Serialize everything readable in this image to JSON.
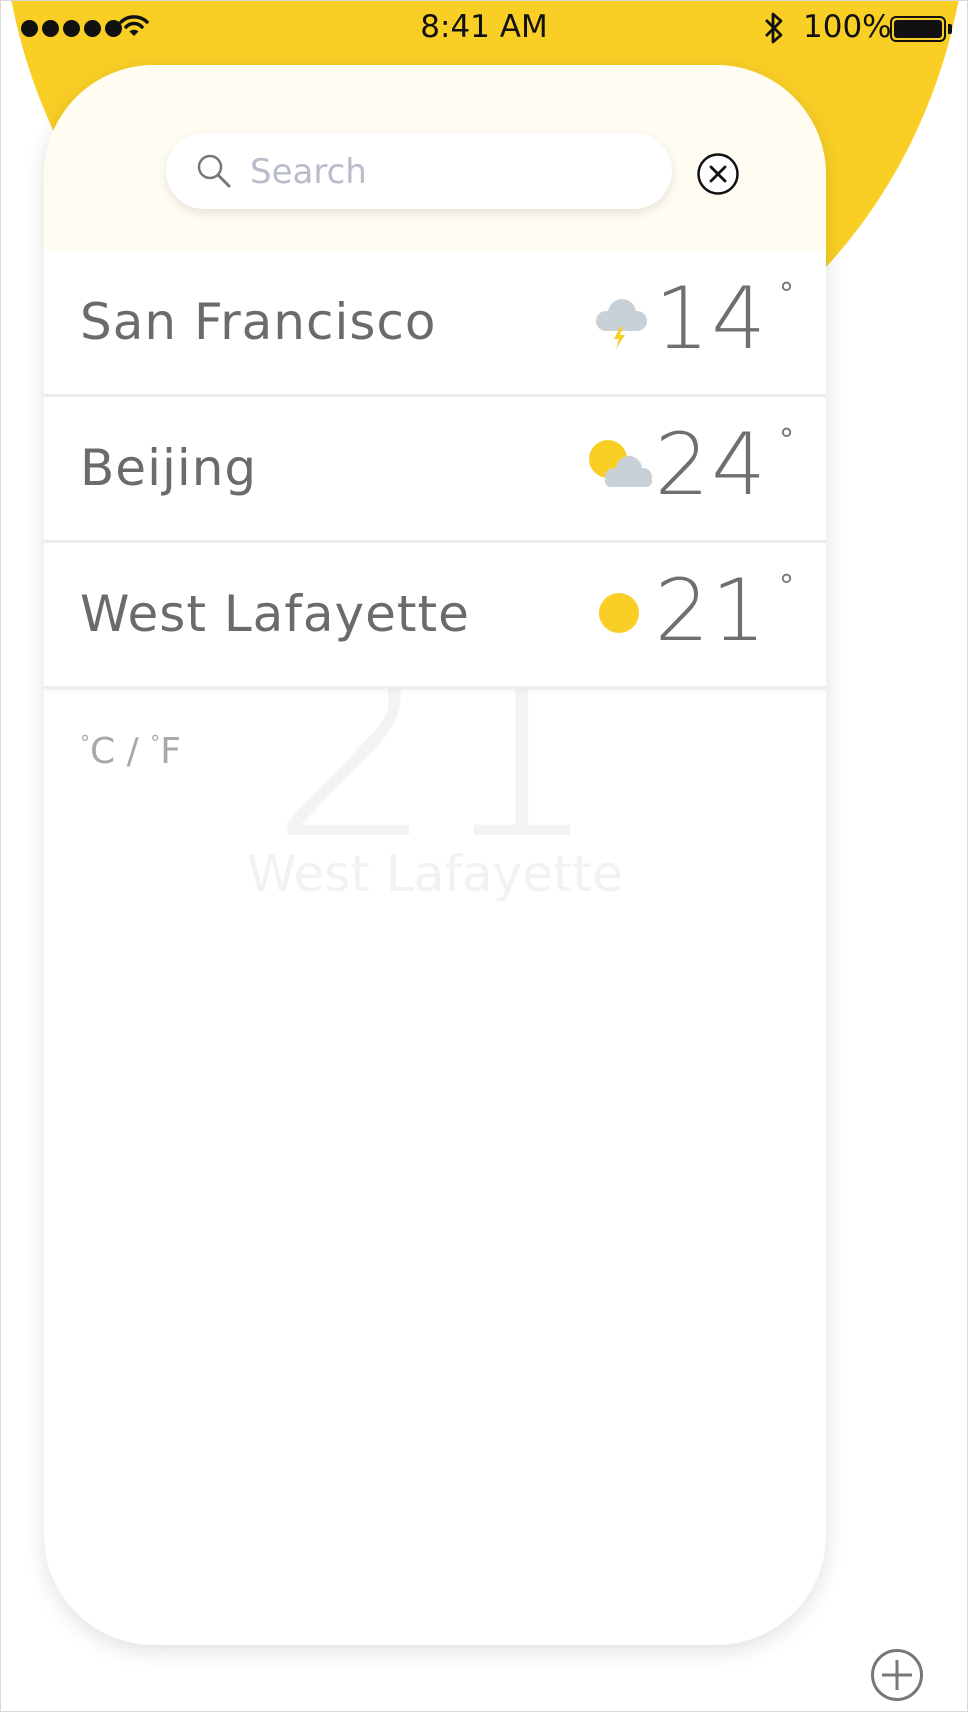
{
  "status_bar": {
    "time": "8:41 AM",
    "battery": "100%"
  },
  "search": {
    "placeholder": "Search"
  },
  "cities": [
    {
      "name": "San Francisco",
      "temp": "14",
      "degree": "°",
      "icon": "thunderstorm-icon"
    },
    {
      "name": "Beijing",
      "temp": "24",
      "degree": "°",
      "icon": "partly-cloudy-icon"
    },
    {
      "name": "West Lafayette",
      "temp": "21",
      "degree": "°",
      "icon": "sun-icon"
    }
  ],
  "background": {
    "temp": "21",
    "city": "West Lafayette"
  },
  "units": {
    "celsius": "C",
    "separator": "/",
    "fahrenheit": "F",
    "degree": "°"
  },
  "colors": {
    "accent": "#f9cf25",
    "cloud": "#c8d1d8",
    "text": "#6b6b6b"
  }
}
